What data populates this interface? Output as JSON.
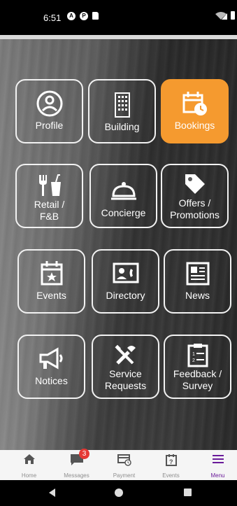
{
  "status_bar": {
    "time": "6:51",
    "icon1": "A",
    "icon2": "P"
  },
  "tiles": [
    {
      "label": "Profile",
      "icon": "user-circle-icon"
    },
    {
      "label": "Building",
      "icon": "building-icon"
    },
    {
      "label": "Bookings",
      "icon": "calendar-clock-icon",
      "active": true
    },
    {
      "label": "Retail / F&B",
      "label1": "Retail /",
      "label2": "F&B",
      "icon": "fork-cup-icon"
    },
    {
      "label": "Concierge",
      "icon": "cloche-icon"
    },
    {
      "label": "Offers / Promotions",
      "label1": "Offers /",
      "label2": "Promotions",
      "icon": "tag-icon"
    },
    {
      "label": "Events",
      "icon": "calendar-star-icon"
    },
    {
      "label": "Directory",
      "icon": "contact-card-icon"
    },
    {
      "label": "News",
      "icon": "newspaper-icon"
    },
    {
      "label": "Notices",
      "icon": "megaphone-icon"
    },
    {
      "label": "Service Requests",
      "label1": "Service",
      "label2": "Requests",
      "icon": "tools-icon"
    },
    {
      "label": "Feedback / Survey",
      "label1": "Feedback /",
      "label2": "Survey",
      "icon": "clipboard-list-icon"
    }
  ],
  "bottom_nav": [
    {
      "label": "Home",
      "icon": "home-icon"
    },
    {
      "label": "Messages",
      "icon": "chat-icon",
      "badge": "3"
    },
    {
      "label": "Payment",
      "icon": "payment-icon"
    },
    {
      "label": "Events",
      "icon": "question-calendar-icon"
    },
    {
      "label": "Menu",
      "icon": "menu-icon",
      "active": true
    }
  ],
  "colors": {
    "accent": "#f59a2f",
    "nav_active": "#6a1b9a",
    "badge": "#e53935"
  }
}
